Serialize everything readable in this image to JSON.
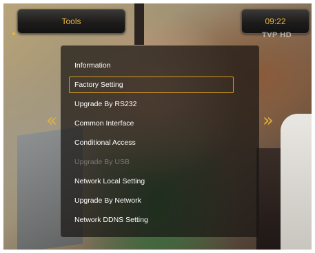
{
  "header": {
    "title": "Tools",
    "time": "09:22"
  },
  "channel_logo": "TVP HD",
  "menu": {
    "items": [
      {
        "label": "Information",
        "state": "normal"
      },
      {
        "label": "Factory Setting",
        "state": "selected"
      },
      {
        "label": "Upgrade By RS232",
        "state": "normal"
      },
      {
        "label": "Common Interface",
        "state": "normal"
      },
      {
        "label": "Conditional Access",
        "state": "normal"
      },
      {
        "label": "Upgrade By USB",
        "state": "disabled"
      },
      {
        "label": "Network Local Setting",
        "state": "normal"
      },
      {
        "label": "Upgrade By Network",
        "state": "normal"
      },
      {
        "label": "Network DDNS Setting",
        "state": "normal"
      }
    ]
  },
  "nav": {
    "left_icon": "chevron-left-icon",
    "right_icon": "chevron-right-icon"
  },
  "colors": {
    "accent": "#e8b83a",
    "selection_border": "#d99a20",
    "text": "#ffffff",
    "disabled_text": "#7b7772"
  }
}
